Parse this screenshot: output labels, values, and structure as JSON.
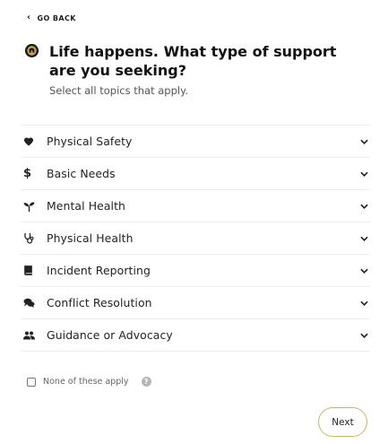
{
  "nav": {
    "back_label": "GO BACK",
    "back_icon": "chevron-left-icon"
  },
  "header": {
    "logo_icon": "university-logo-icon",
    "title": "Life happens. What type of support are you seeking?",
    "subtitle": "Select all topics that apply."
  },
  "topics": [
    {
      "label": "Physical Safety",
      "icon": "heart-icon"
    },
    {
      "label": "Basic Needs",
      "icon": "dollar-icon"
    },
    {
      "label": "Mental Health",
      "icon": "sprout-icon"
    },
    {
      "label": "Physical Health",
      "icon": "stethoscope-icon"
    },
    {
      "label": "Incident Reporting",
      "icon": "book-icon"
    },
    {
      "label": "Conflict Resolution",
      "icon": "chat-bubbles-icon"
    },
    {
      "label": "Guidance or Advocacy",
      "icon": "people-icon"
    }
  ],
  "none_option": {
    "label": "None of these apply",
    "checked": false,
    "help_icon": "question-icon"
  },
  "actions": {
    "next_label": "Next"
  },
  "colors": {
    "accent_border": "#cbb36a",
    "text": "#222222",
    "muted": "#555555",
    "divider": "#ececec"
  }
}
